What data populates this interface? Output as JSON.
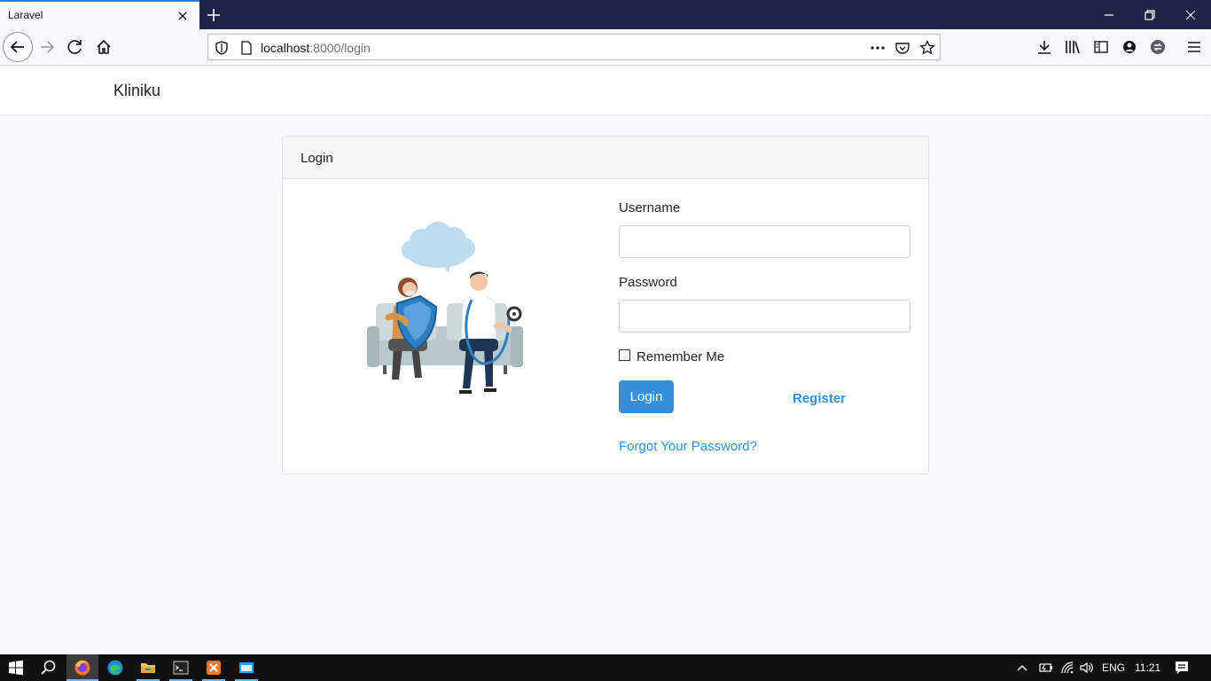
{
  "browser": {
    "tab_title": "Laravel",
    "url_host": "localhost",
    "url_path": ":8000/login",
    "icons": [
      "close-icon",
      "plus-icon",
      "minimize-icon",
      "restore-icon",
      "window-close-icon",
      "back-icon",
      "forward-icon",
      "reload-icon",
      "home-icon",
      "shield-icon",
      "page-icon",
      "more-icon",
      "pocket-icon",
      "star-icon",
      "download-icon",
      "library-icon",
      "sidebar-icon",
      "account-icon",
      "sync-icon",
      "menu-icon"
    ]
  },
  "app": {
    "brand": "Kliniku"
  },
  "login_card": {
    "header": "Login",
    "username_label": "Username",
    "username_value": "",
    "password_label": "Password",
    "password_value": "",
    "remember_label": "Remember Me",
    "remember_checked": false,
    "login_button": "Login",
    "register_link": "Register",
    "forgot_link": "Forgot Your Password?"
  },
  "taskbar": {
    "language": "ENG",
    "time": "11:21"
  },
  "colors": {
    "primary": "#3490dc",
    "tabbar": "#1f2347",
    "page_bg": "#f8fafc"
  }
}
